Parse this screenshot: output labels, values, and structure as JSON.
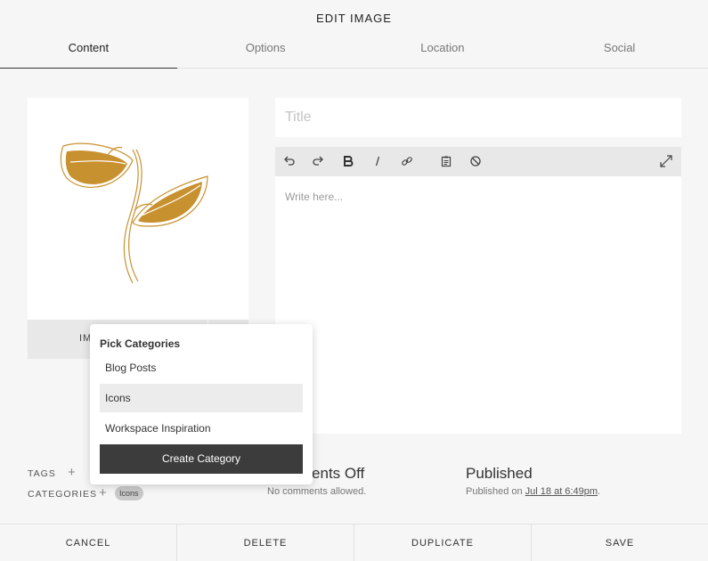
{
  "header": {
    "title": "EDIT IMAGE",
    "tabs": [
      {
        "label": "Content",
        "active": true
      },
      {
        "label": "Options",
        "active": false
      },
      {
        "label": "Location",
        "active": false
      },
      {
        "label": "Social",
        "active": false
      }
    ]
  },
  "image": {
    "bar_label": "IMAGE",
    "accent_color": "#c8912f"
  },
  "editor": {
    "title_placeholder": "Title",
    "body_placeholder": "Write here...",
    "toolbar_icons": [
      "undo-icon",
      "redo-icon",
      "bold-icon",
      "italic-icon",
      "link-icon",
      "clipboard-icon",
      "clear-format-icon",
      "expand-icon"
    ]
  },
  "meta": {
    "tags_label": "TAGS",
    "categories_label": "CATEGORIES",
    "category_chip": "Icons",
    "comments_title": "Comments Off",
    "comments_sub": "No comments allowed.",
    "published_title": "Published",
    "published_prefix": "Published on ",
    "published_date": "Jul 18 at 6:49pm",
    "published_suffix": "."
  },
  "category_picker": {
    "title": "Pick Categories",
    "items": [
      {
        "label": "Blog Posts",
        "selected": false
      },
      {
        "label": "Icons",
        "selected": true
      },
      {
        "label": "Workspace Inspiration",
        "selected": false
      }
    ],
    "create_label": "Create Category"
  },
  "footer": {
    "cancel": "CANCEL",
    "delete": "DELETE",
    "duplicate": "DUPLICATE",
    "save": "SAVE"
  }
}
